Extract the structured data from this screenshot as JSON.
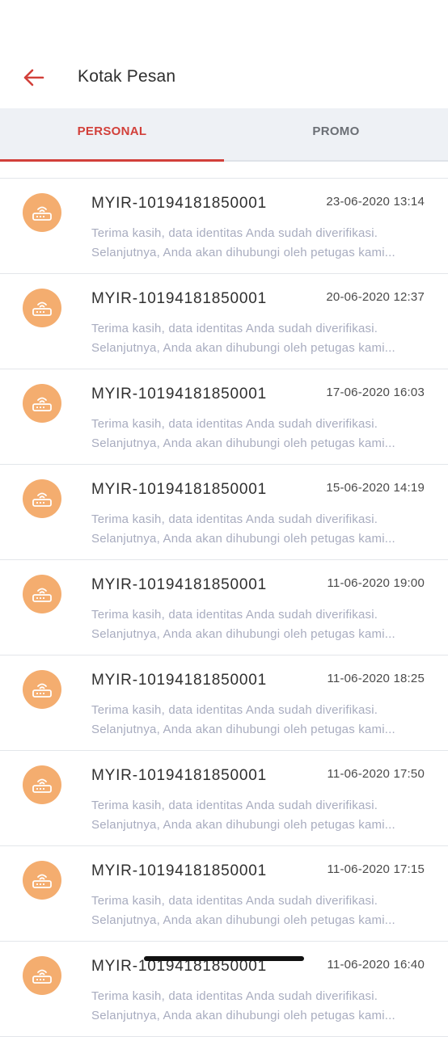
{
  "header": {
    "title": "Kotak Pesan",
    "back_icon": "arrow-left-icon"
  },
  "tabs": [
    {
      "label": "PERSONAL",
      "active": true
    },
    {
      "label": "PROMO",
      "active": false
    }
  ],
  "colors": {
    "accent": "#d2403a",
    "avatar_bg": "#f4ad6f",
    "tab_bar_bg": "#eef1f5",
    "preview_text": "#a8acbf"
  },
  "messages": [
    {
      "icon": "router-icon",
      "title": "MYIR-10194181850001",
      "date": "23-06-2020 13:14",
      "line1": "Terima kasih, data identitas Anda sudah diverifikasi.",
      "line2": "Selanjutnya, Anda akan dihubungi oleh petugas kami..."
    },
    {
      "icon": "router-icon",
      "title": "MYIR-10194181850001",
      "date": "20-06-2020 12:37",
      "line1": "Terima kasih, data identitas Anda sudah diverifikasi.",
      "line2": "Selanjutnya, Anda akan dihubungi oleh petugas kami..."
    },
    {
      "icon": "router-icon",
      "title": "MYIR-10194181850001",
      "date": "17-06-2020 16:03",
      "line1": "Terima kasih, data identitas Anda sudah diverifikasi.",
      "line2": "Selanjutnya, Anda akan dihubungi oleh petugas kami..."
    },
    {
      "icon": "router-icon",
      "title": "MYIR-10194181850001",
      "date": "15-06-2020 14:19",
      "line1": "Terima kasih, data identitas Anda sudah diverifikasi.",
      "line2": "Selanjutnya, Anda akan dihubungi oleh petugas kami..."
    },
    {
      "icon": "router-icon",
      "title": "MYIR-10194181850001",
      "date": "11-06-2020 19:00",
      "line1": "Terima kasih, data identitas Anda sudah diverifikasi.",
      "line2": "Selanjutnya, Anda akan dihubungi oleh petugas kami..."
    },
    {
      "icon": "router-icon",
      "title": "MYIR-10194181850001",
      "date": "11-06-2020 18:25",
      "line1": "Terima kasih, data identitas Anda sudah diverifikasi.",
      "line2": "Selanjutnya, Anda akan dihubungi oleh petugas kami..."
    },
    {
      "icon": "router-icon",
      "title": "MYIR-10194181850001",
      "date": "11-06-2020 17:50",
      "line1": "Terima kasih, data identitas Anda sudah diverifikasi.",
      "line2": "Selanjutnya, Anda akan dihubungi oleh petugas kami..."
    },
    {
      "icon": "router-icon",
      "title": "MYIR-10194181850001",
      "date": "11-06-2020 17:15",
      "line1": "Terima kasih, data identitas Anda sudah diverifikasi.",
      "line2": "Selanjutnya, Anda akan dihubungi oleh petugas kami..."
    },
    {
      "icon": "router-icon",
      "title": "MYIR-10194181850001",
      "date": "11-06-2020 16:40",
      "line1": "Terima kasih, data identitas Anda sudah diverifikasi.",
      "line2": "Selanjutnya, Anda akan dihubungi oleh petugas kami..."
    }
  ]
}
